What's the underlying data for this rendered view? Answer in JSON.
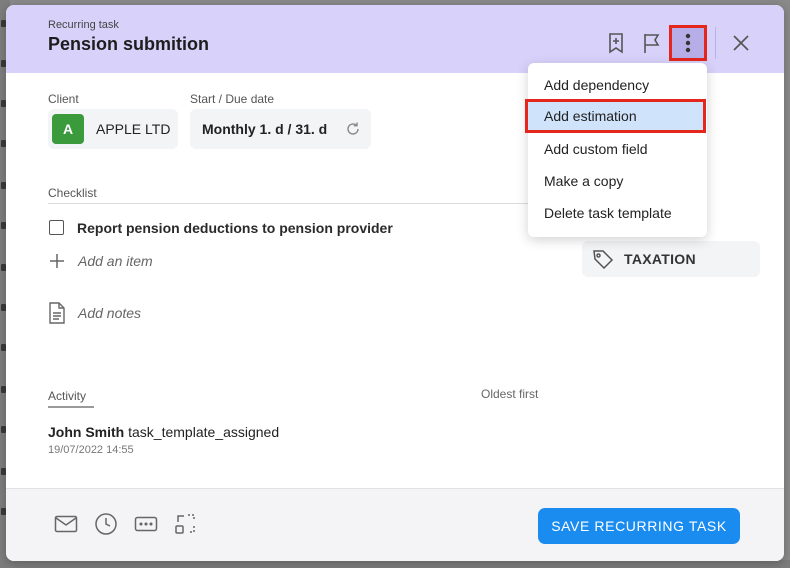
{
  "header": {
    "kicker": "Recurring task",
    "title": "Pension submition"
  },
  "client": {
    "label": "Client",
    "avatar_letter": "A",
    "name": "APPLE LTD"
  },
  "due": {
    "label": "Start / Due date",
    "value": "Monthly 1. d / 31. d"
  },
  "checklist": {
    "label": "Checklist",
    "items": [
      "Report pension deductions to pension provider"
    ],
    "add_item_placeholder": "Add an item"
  },
  "notes": {
    "placeholder": "Add notes"
  },
  "tag": {
    "label": "TAXATION"
  },
  "activity": {
    "label": "Activity",
    "sort_label": "Oldest first",
    "entries": [
      {
        "user": "John Smith",
        "action": "task_template_assigned",
        "timestamp": "19/07/2022 14:55"
      }
    ]
  },
  "footer": {
    "save_label": "SAVE RECURRING TASK"
  },
  "menu": {
    "items": [
      "Add dependency",
      "Add estimation",
      "Add custom field",
      "Make a copy",
      "Delete task template"
    ]
  },
  "colors": {
    "header_bg": "#d8d2fa",
    "primary": "#1a8cf0",
    "highlight_border": "#e4261c",
    "avatar_bg": "#3a9a3c"
  },
  "icons": {
    "header": [
      "bookmark-add-icon",
      "flag-icon",
      "more-vertical-icon",
      "close-icon"
    ],
    "footer": [
      "email-icon",
      "clock-icon",
      "more-horizontal-icon",
      "expand-icon"
    ]
  }
}
